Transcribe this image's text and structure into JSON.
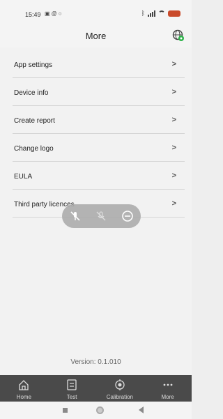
{
  "status_bar": {
    "time": "15:49",
    "left_icons": [
      "message-icon",
      "at-sign-icon",
      "sync-icon"
    ],
    "right_icons": [
      "bluetooth-icon",
      "signal-icon",
      "wifi-icon",
      "battery-icon"
    ]
  },
  "header": {
    "title": "More",
    "settings_icon": "globe-settings-icon",
    "accent_color": "#2db34a"
  },
  "menu": {
    "items": [
      {
        "label": "App settings"
      },
      {
        "label": "Device info"
      },
      {
        "label": "Create report"
      },
      {
        "label": "Change logo"
      },
      {
        "label": "EULA"
      },
      {
        "label": "Third party licences"
      }
    ]
  },
  "overlay": {
    "icons": [
      "mic-off-icon",
      "mic-muted-icon",
      "minus-circle-icon"
    ]
  },
  "footer": {
    "version": "Version: 0.1.010"
  },
  "tabs": [
    {
      "label": "Home",
      "icon": "home-icon"
    },
    {
      "label": "Test",
      "icon": "test-icon"
    },
    {
      "label": "Calibration",
      "icon": "calibration-icon"
    },
    {
      "label": "More",
      "icon": "more-icon"
    }
  ],
  "colors": {
    "tab_bar_bg": "#4a4a4a",
    "background": "#f2f2f2",
    "battery": "#c94a2a"
  }
}
